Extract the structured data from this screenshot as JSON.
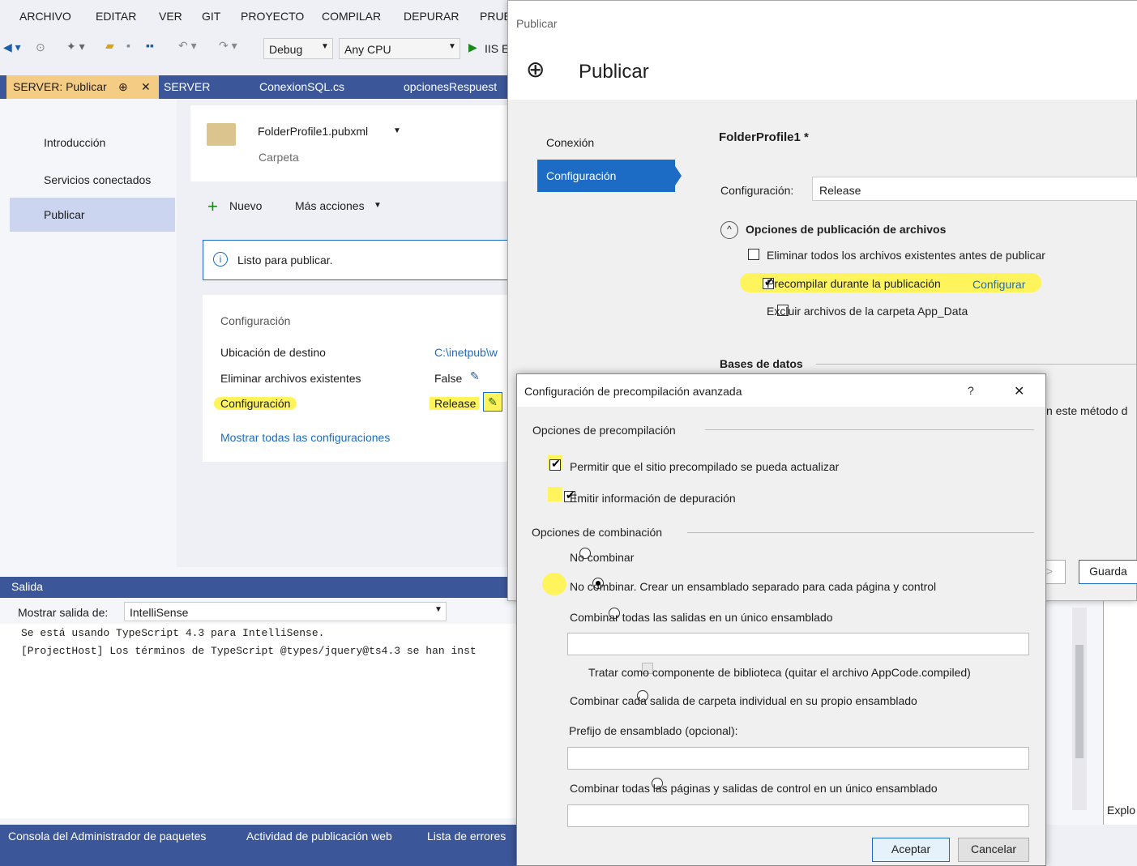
{
  "vs": {
    "menu": [
      "ARCHIVO",
      "EDITAR",
      "VER",
      "GIT",
      "PROYECTO",
      "COMPILAR",
      "DEPURAR",
      "PRUE"
    ],
    "toolbar": {
      "config": "Debug",
      "platform": "Any CPU",
      "run": "IIS E"
    },
    "tabs": [
      "SERVER: Publicar",
      "SERVER",
      "ConexionSQL.cs",
      "opcionesRespuest"
    ],
    "pin_glyph": "⊕",
    "close_glyph": "✕",
    "nav": [
      "Introducción",
      "Servicios conectados",
      "Publicar"
    ],
    "profile": {
      "name": "FolderProfile1.pubxml",
      "type": "Carpeta"
    },
    "actions": {
      "new": "Nuevo",
      "more": "Más acciones"
    },
    "ready": "Listo para publicar.",
    "settings": {
      "title": "Configuración",
      "rows": [
        {
          "label": "Ubicación de destino",
          "value": "C:\\inetpub\\w"
        },
        {
          "label": "Eliminar archivos existentes",
          "value": "False"
        },
        {
          "label": "Configuración",
          "value": "Release"
        }
      ],
      "show_all": "Mostrar todas las configuraciones"
    },
    "output": {
      "title": "Salida",
      "show_from_label": "Mostrar salida de:",
      "show_from_value": "IntelliSense",
      "lines": [
        "Se está usando TypeScript 4.3 para IntelliSense.",
        "[ProjectHost] Los términos de TypeScript @types/jquery@ts4.3 se han inst"
      ]
    },
    "bottom_tabs": [
      "Consola del Administrador de paquetes",
      "Actividad de publicación web",
      "Lista de errores"
    ],
    "right_partial": "Explo"
  },
  "publish": {
    "window_title": "Publicar",
    "header": "Publicar",
    "nav": [
      "Conexión",
      "Configuración"
    ],
    "profile_title": "FolderProfile1 *",
    "config_label": "Configuración:",
    "config_value": "Release",
    "file_options_title": "Opciones de publicación de archivos",
    "options": [
      {
        "label": "Eliminar todos los archivos existentes antes de publicar",
        "checked": false
      },
      {
        "label": "Precompilar durante la publicación",
        "checked": true
      },
      {
        "label": "Excluir archivos de la carpeta App_Data",
        "checked": false
      }
    ],
    "configure_link": "Configurar",
    "databases_title": "Bases de datos",
    "partial_text": "n este método d",
    "prev_partial": "e >",
    "save_partial": "Guarda"
  },
  "dialog": {
    "title": "Configuración de precompilación avanzada",
    "help": "?",
    "close": "✕",
    "precompile_group": "Opciones de precompilación",
    "precompile_options": [
      {
        "label": "Permitir que el sitio precompilado se pueda actualizar",
        "checked": true
      },
      {
        "label": "Emitir información de depuración",
        "checked": true
      }
    ],
    "merge_group": "Opciones de combinación",
    "merge_options": [
      "No combinar",
      "No combinar. Crear un ensamblado separado para cada página y control",
      "Combinar todas las salidas en un único ensamblado",
      "Combinar cada salida de carpeta individual en su propio ensamblado",
      "Combinar todas las páginas y salidas de control en un único ensamblado"
    ],
    "selected_merge": 1,
    "library_checkbox": "Tratar como componente de biblioteca (quitar el archivo AppCode.compiled)",
    "prefix_label": "Prefijo de ensamblado (opcional):",
    "ok": "Aceptar",
    "cancel": "Cancelar"
  }
}
